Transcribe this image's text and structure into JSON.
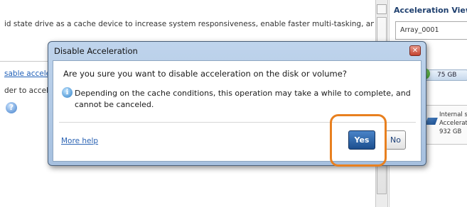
{
  "background": {
    "description_text": "id state drive as a cache device to increase system responsiveness, enable faster multi-tasking, and extend battery",
    "link_text": "sable acceler",
    "secondary_text": "der to acceler"
  },
  "acceleration_panel": {
    "title": "Acceleration View",
    "array_name": "Array_0001",
    "cache_disk_size": "75 GB",
    "disk": {
      "line1": "Internal s",
      "line2": "Accelerat",
      "line3": "932 GB"
    }
  },
  "dialog": {
    "title": "Disable Acceleration",
    "close_glyph": "✕",
    "question": "Are you sure you want to disable acceleration on the disk or volume?",
    "info_icon_glyph": "i",
    "info_text": "Depending on the cache conditions, this operation may take a while to complete, and cannot be canceled.",
    "more_help": "More help",
    "yes_label": "Yes",
    "no_label": "No"
  },
  "colors": {
    "highlight": "#e8801f",
    "dialog_frame": "#a6c0df",
    "primary_button": "#1c4f8f"
  }
}
